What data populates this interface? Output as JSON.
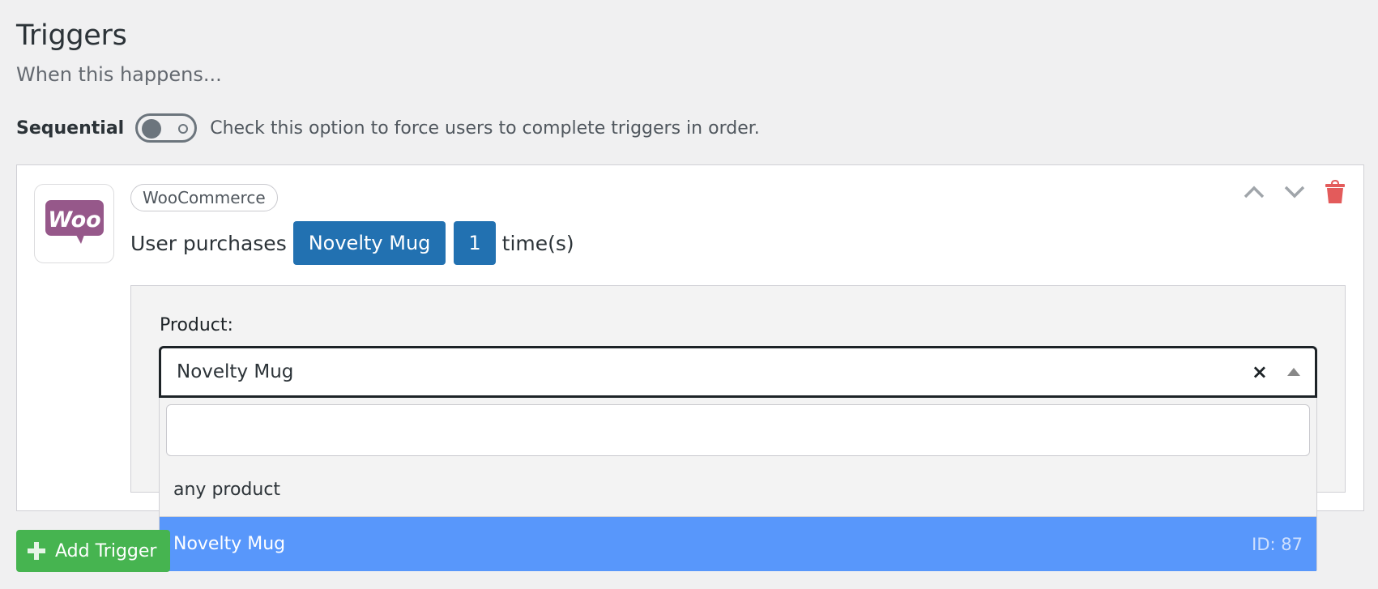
{
  "header": {
    "title": "Triggers",
    "subtitle": "When this happens..."
  },
  "sequential": {
    "label": "Sequential",
    "enabled": false,
    "help": "Check this option to force users to complete triggers in order."
  },
  "trigger": {
    "integration_icon": "woocommerce-logo-icon",
    "integration_name": "WooCommerce",
    "sentence_prefix": "User purchases",
    "product_pill": "Novelty Mug",
    "count_pill": "1",
    "sentence_suffix": "time(s)",
    "actions": {
      "move_up_icon": "chevron-up-icon",
      "move_down_icon": "chevron-down-icon",
      "delete_icon": "trash-icon"
    },
    "settings": {
      "product_label": "Product:",
      "selected_value": "Novelty Mug",
      "clear_symbol": "×",
      "search_value": "",
      "options": [
        {
          "label": "any product",
          "id_text": ""
        },
        {
          "label": "Novelty Mug",
          "id_text": "ID: 87"
        }
      ],
      "highlighted_option": 1
    }
  },
  "footer": {
    "add_trigger_label": "Add Trigger"
  },
  "colors": {
    "primary": "#2271b1",
    "success": "#46b450",
    "danger": "#e35b5b",
    "highlight": "#5897fb",
    "woo_purple": "#96588a"
  }
}
